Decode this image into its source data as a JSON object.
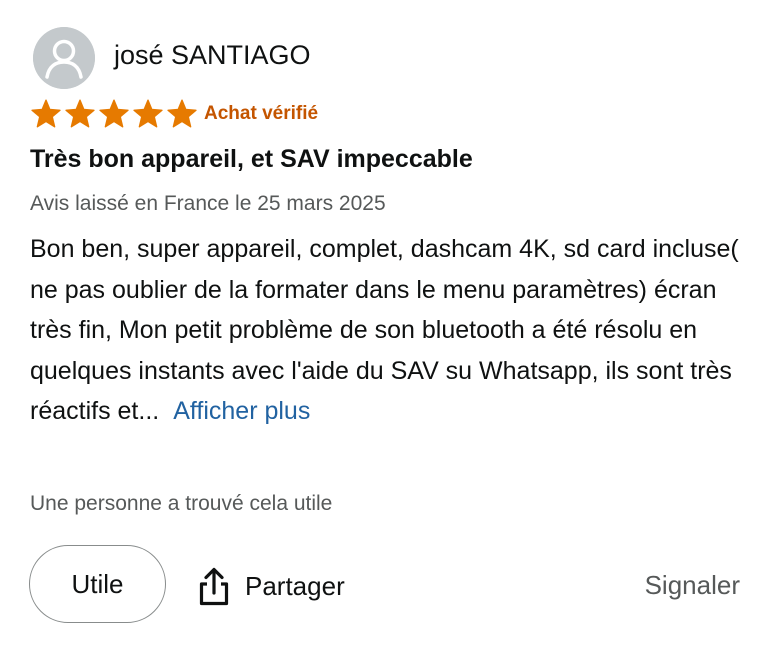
{
  "reviewer": {
    "name": "josé SANTIAGO",
    "avatar_icon": "user-silhouette-icon"
  },
  "rating": {
    "stars": 5,
    "max": 5,
    "color": "#e67a00",
    "icon": "star-icon"
  },
  "verified_label": "Achat vérifié",
  "title": "Très bon appareil, et SAV impeccable",
  "meta": "Avis laissé en France le 25 mars 2025",
  "body": "Bon ben, super appareil, complet, dashcam 4K, sd card incluse( ne pas oublier de la formater dans le menu paramètres) écran très fin, Mon petit problème de son bluetooth a été résolu en quelques instants avec l'aide du SAV su Whatsapp, ils sont très réactifs et...",
  "show_more_label": "Afficher plus",
  "helpful_text": "Une personne a trouvé cela utile",
  "actions": {
    "useful_label": "Utile",
    "share_label": "Partager",
    "share_icon": "share-icon",
    "report_label": "Signaler"
  },
  "colors": {
    "link": "#2162a1",
    "verified": "#c45500",
    "secondary_text": "#565959"
  }
}
